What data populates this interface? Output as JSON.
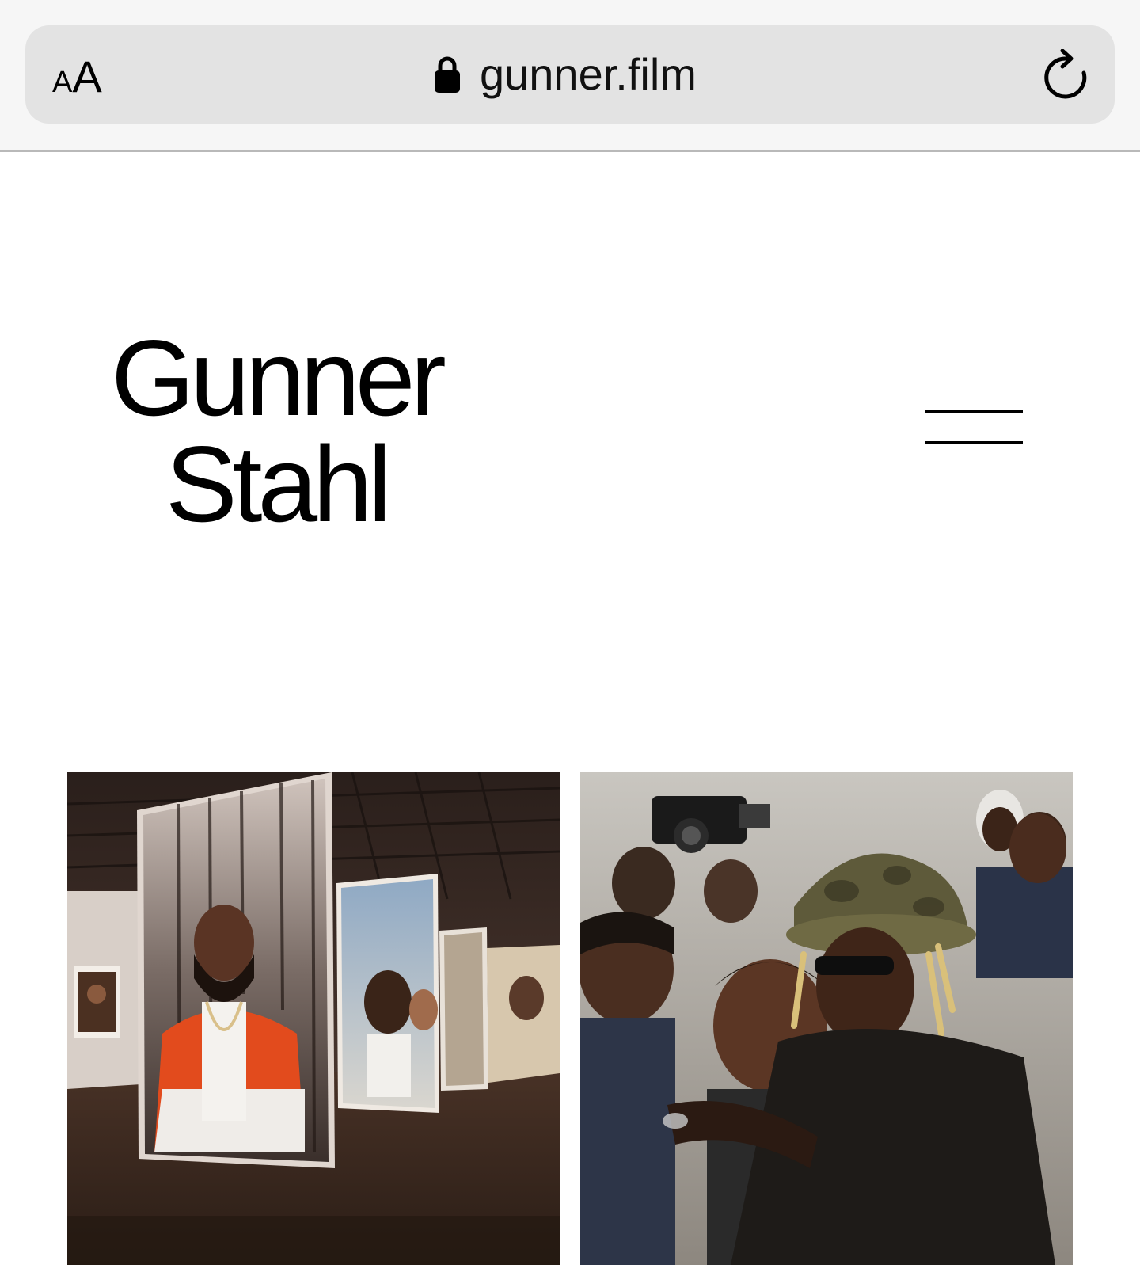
{
  "browser": {
    "text_size_small": "A",
    "text_size_big": "A",
    "url": "gunner.film",
    "icons": {
      "lock": "lock-icon",
      "reload": "reload-icon"
    }
  },
  "header": {
    "title_line1": "Gunner",
    "title_line2": "Stahl",
    "menu_icon": "hamburger-menu-icon"
  },
  "gallery": {
    "items": [
      {
        "description_name": "gallery-exhibition-photo"
      },
      {
        "description_name": "crowd-portrait-photo"
      }
    ],
    "colors": {
      "left_warm": "#6b4a3a",
      "right_dark": "#1e1b18"
    }
  }
}
